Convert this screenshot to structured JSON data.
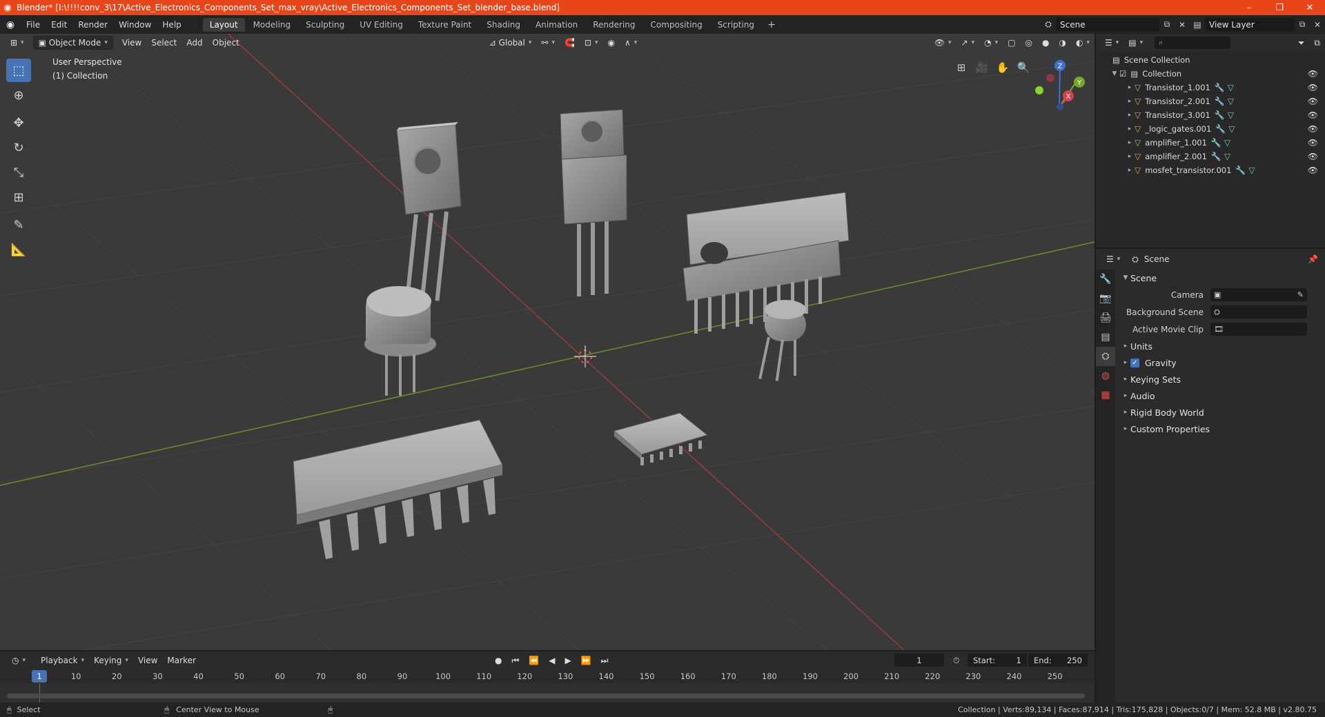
{
  "window": {
    "title": "Blender* [I:\\!!!!conv_3\\17\\Active_Electronics_Components_Set_max_vray\\Active_Electronics_Components_Set_blender_base.blend]"
  },
  "menubar": {
    "menus": [
      "File",
      "Edit",
      "Render",
      "Window",
      "Help"
    ],
    "workspaces": [
      "Layout",
      "Modeling",
      "Sculpting",
      "UV Editing",
      "Texture Paint",
      "Shading",
      "Animation",
      "Rendering",
      "Compositing",
      "Scripting"
    ],
    "active_workspace": "Layout",
    "scene": "Scene",
    "view_layer": "View Layer"
  },
  "viewport": {
    "mode": "Object Mode",
    "menus": [
      "View",
      "Select",
      "Add",
      "Object"
    ],
    "transform_orientation": "Global",
    "perspective": "User Perspective",
    "collection": "(1) Collection",
    "axis_labels": {
      "x": "X",
      "y": "Y",
      "z": "Z"
    }
  },
  "outliner": {
    "root": "Scene Collection",
    "collection": "Collection",
    "objects": [
      "Transistor_1.001",
      "Transistor_2.001",
      "Transistor_3.001",
      "_logic_gates.001",
      "amplifier_1.001",
      "amplifier_2.001",
      "mosfet_transistor.001"
    ]
  },
  "properties": {
    "context": "Scene",
    "panel": "Scene",
    "fields": [
      {
        "label": "Camera",
        "value": ""
      },
      {
        "label": "Background Scene",
        "value": ""
      },
      {
        "label": "Active Movie Clip",
        "value": ""
      }
    ],
    "sections": [
      "Units",
      "Gravity",
      "Keying Sets",
      "Audio",
      "Rigid Body World",
      "Custom Properties"
    ],
    "gravity_enabled": true
  },
  "timeline": {
    "menus": [
      "Playback",
      "Keying",
      "View",
      "Marker"
    ],
    "current_frame": "1",
    "start_label": "Start:",
    "start": "1",
    "end_label": "End:",
    "end": "250",
    "ticks": [
      "10",
      "20",
      "30",
      "40",
      "50",
      "60",
      "70",
      "80",
      "90",
      "100",
      "110",
      "120",
      "130",
      "140",
      "150",
      "160",
      "170",
      "180",
      "190",
      "200",
      "210",
      "220",
      "230",
      "240",
      "250"
    ]
  },
  "statusbar": {
    "left_action": "Select",
    "mid_action": "Center View to Mouse",
    "stats": "Collection | Verts:89,134 | Faces:87,914 | Tris:175,828 | Objects:0/7 | Mem: 52.8 MB | v2.80.75"
  }
}
